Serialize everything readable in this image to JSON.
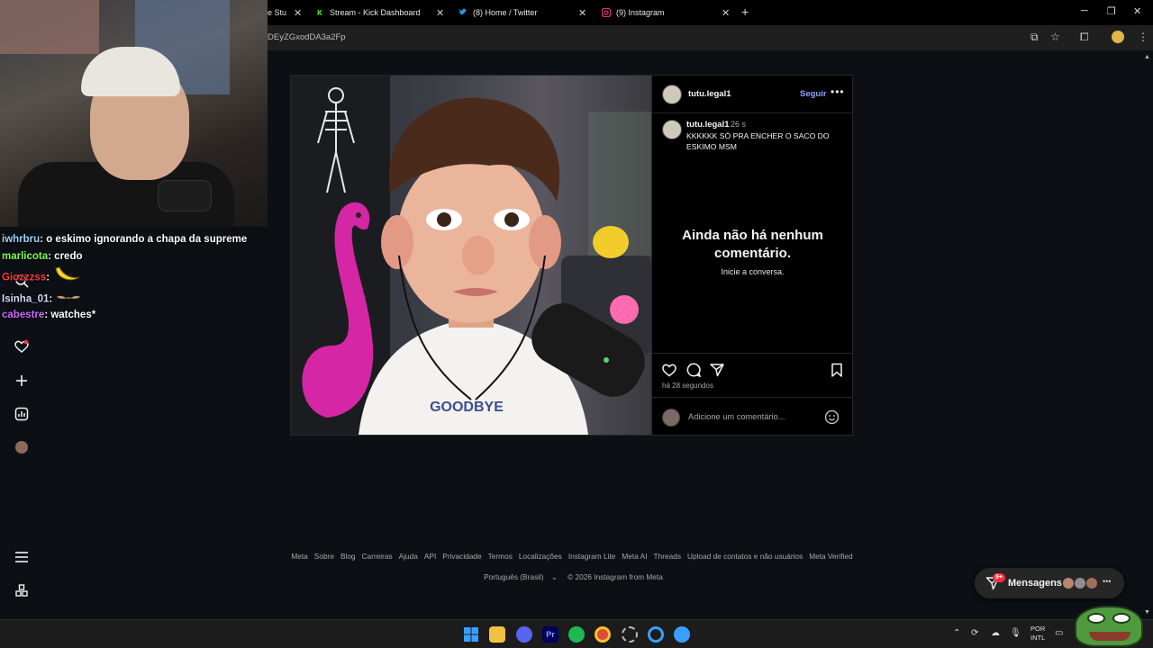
{
  "browser": {
    "tabs": [
      {
        "label": "e Stu",
        "icon": "tab-favicon-icon"
      },
      {
        "label": "Stream - Kick Dashboard",
        "icon": "kick-icon"
      },
      {
        "label": "(8) Home / Twitter",
        "icon": "twitter-icon"
      },
      {
        "label": "(9) Instagram",
        "icon": "instagram-icon"
      }
    ],
    "url": "DEyZGxodDA3a2Fp"
  },
  "chat": [
    {
      "user": "iwhrbru",
      "color": "#9fd3ff",
      "message": "o eskimo ignorando a chapa da supreme"
    },
    {
      "user": "marlicota",
      "color": "#7cff4f",
      "message": "credo"
    },
    {
      "user": "Giozzzss",
      "color": "#ff3b3b",
      "message": ""
    },
    {
      "user": "Isinha_01",
      "color": "#d9d9ff",
      "message": ""
    },
    {
      "user": "cabestre",
      "color": "#c96bff",
      "message": "watches*"
    }
  ],
  "post": {
    "username": "tutu.legal1",
    "follow_label": "Seguir",
    "caption_user": "tutu.legal1",
    "caption_time": "26 s",
    "caption": "KKKKKK SÓ PRA ENCHER O SACO DO ESKIMO MSM",
    "empty_title": "Ainda não há nenhum comentário.",
    "empty_subtitle": "Inicie a conversa.",
    "posted_ago": "há 28 segundos",
    "comment_placeholder": "Adicione um comentário...",
    "shirt_text": "GOODBYE"
  },
  "footer": {
    "links": [
      "Meta",
      "Sobre",
      "Blog",
      "Carreiras",
      "Ajuda",
      "API",
      "Privacidade",
      "Termos",
      "Localizações",
      "Instagram Lite",
      "Meta AI",
      "Threads",
      "Upload de contatos e não usuários",
      "Meta Verified"
    ],
    "language": "Português (Brasil)",
    "copyright": "© 2026 Instagram from Meta"
  },
  "messages": {
    "label": "Mensagens",
    "badge": "9+"
  },
  "taskbar": {
    "language_line1": "POR",
    "language_line2": "INTL"
  },
  "colors": {
    "background": "#0c1014",
    "accent_link": "#8ea5ff",
    "badge": "#ff3040"
  }
}
